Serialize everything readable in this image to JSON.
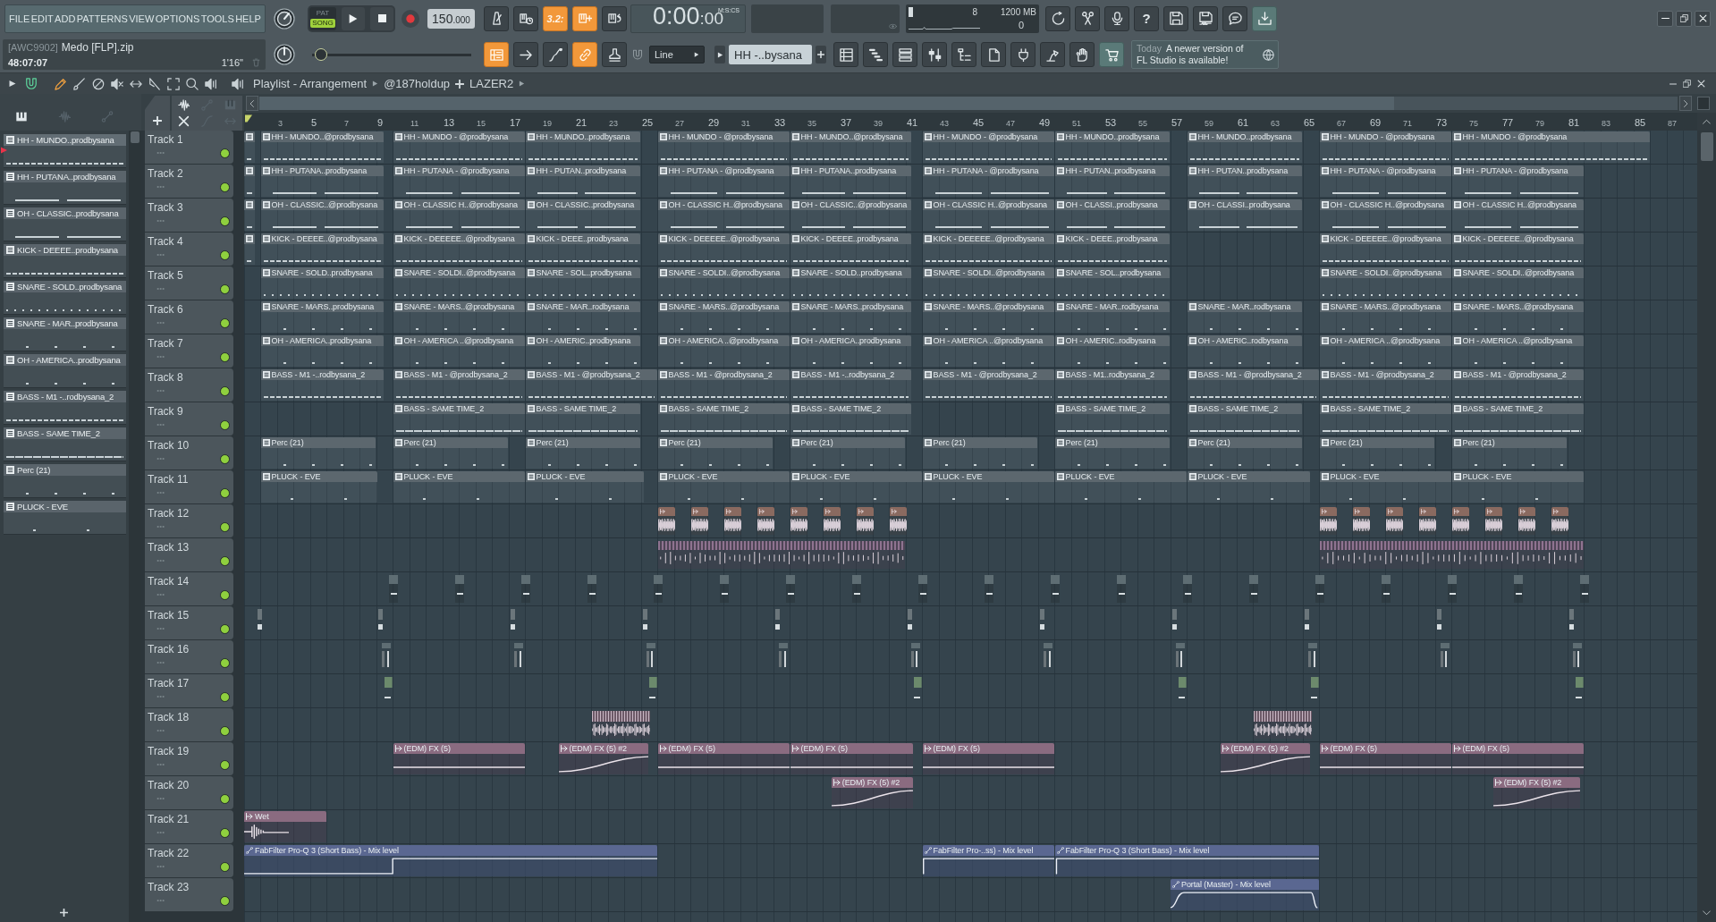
{
  "menu": [
    "FILE",
    "EDIT",
    "ADD",
    "PATTERNS",
    "VIEW",
    "OPTIONS",
    "TOOLS",
    "HELP"
  ],
  "transport": {
    "modes": [
      {
        "label": "PAT",
        "selected": false
      },
      {
        "label": "SONG",
        "selected": true
      }
    ]
  },
  "tempo": {
    "whole": "150",
    "fraction": ".000"
  },
  "record_toggles": [
    {
      "on": false
    },
    {
      "on": false
    },
    {
      "label": "3.2:",
      "on": true
    },
    {
      "on": true
    },
    {
      "on": false
    }
  ],
  "time": {
    "main": "0:00",
    "sub": ":00",
    "unit": "M:S:CS"
  },
  "monitor": {
    "readings": [
      "8",
      "1200 MB",
      "0"
    ]
  },
  "system_buttons": [
    {
      "on": false
    },
    {
      "on": false
    },
    {
      "on": false
    },
    {
      "label": "?",
      "on": false
    },
    {
      "on": false
    },
    {
      "on": false
    },
    {
      "on": false
    },
    {
      "on": true
    }
  ],
  "song": {
    "tag": "[AWC9902]",
    "file": "Medo [FLP].zip",
    "position": "48:07:07",
    "length": "1'16\""
  },
  "slider": {
    "level": 0.03
  },
  "view_toggles": [
    {
      "on": true
    },
    {
      "on": false
    },
    {
      "on": false
    },
    {
      "on": true
    },
    {
      "on": false
    }
  ],
  "snap": {
    "value": "Line"
  },
  "pattern_selector": {
    "value": "HH -..bysana"
  },
  "windows": [
    {
      "on": false
    },
    {
      "on": false
    },
    {
      "on": false
    },
    {
      "on": false
    },
    {
      "on": false
    },
    {
      "on": false
    },
    {
      "on": false
    },
    {
      "on": false
    },
    {
      "on": false
    },
    {
      "on": true
    }
  ],
  "news": {
    "date": "Today",
    "lines": [
      "A newer version of",
      "FL Studio is available!"
    ]
  },
  "playlist": {
    "snap_on": true,
    "tools": [
      {
        "selected": true
      },
      {
        "selected": false
      },
      {
        "selected": false
      },
      {
        "selected": false
      },
      {
        "selected": false
      },
      {
        "selected": false
      },
      {
        "selected": false
      },
      {
        "selected": false
      },
      {
        "selected": false
      }
    ],
    "breadcrumb": [
      "Playlist - Arrangement",
      "@187holdup",
      "LAZER2"
    ],
    "ruler": [
      "3",
      "5",
      "7",
      "9",
      "11",
      "13",
      "15",
      "17",
      "19",
      "21",
      "23",
      "25",
      "27",
      "29",
      "31",
      "33",
      "35",
      "37",
      "39",
      "41",
      "43",
      "45",
      "47",
      "49",
      "51",
      "53",
      "55",
      "57",
      "59",
      "61",
      "63",
      "65",
      "67",
      "69",
      "71",
      "73",
      "75",
      "77",
      "79",
      "81",
      "83",
      "85",
      "87"
    ]
  },
  "pattern_picker": {
    "items": [
      {
        "name": "HH - MUNDO..prodbysana",
        "selected": true
      },
      {
        "name": "HH - PUTANA..prodbysana",
        "selected": false
      },
      {
        "name": "OH - CLASSIC..prodbysana",
        "selected": false
      },
      {
        "name": "KICK - DEEEE..prodbysana",
        "selected": false
      },
      {
        "name": "SNARE - SOLD..prodbysana",
        "selected": false
      },
      {
        "name": "SNARE - MAR..prodbysana",
        "selected": false
      },
      {
        "name": "OH - AMERICA..prodbysana",
        "selected": false
      },
      {
        "name": "BASS - M1 -..rodbysana_2",
        "selected": false
      },
      {
        "name": "BASS - SAME TIME_2",
        "selected": false
      },
      {
        "name": "Perc (21)",
        "selected": false
      },
      {
        "name": "PLUCK - EVE",
        "selected": false
      }
    ]
  },
  "tracks": [
    {
      "name": "Track 1",
      "enabled": true,
      "clips": [
        {
          "kind": "pattern"
        },
        {
          "kind": "pattern",
          "label": "HH - MUNDO..@prodbysana"
        },
        {
          "kind": "pattern",
          "label": "HH - MUNDO - @prodbysana"
        },
        {
          "kind": "pattern",
          "label": "HH - MUNDO..prodbysana"
        },
        {
          "kind": "pattern",
          "label": "HH - MUNDO - @prodbysana"
        },
        {
          "kind": "pattern",
          "label": "HH - MUNDO..@prodbysana"
        },
        {
          "kind": "pattern",
          "label": "HH - MUNDO - @prodbysana"
        },
        {
          "kind": "pattern",
          "label": "HH - MUNDO..prodbysana"
        },
        {
          "kind": "pattern",
          "label": "HH - MUNDO..prodbysana"
        },
        {
          "kind": "pattern",
          "label": "HH - MUNDO - @prodbysana"
        },
        {
          "kind": "pattern",
          "label": "HH - MUNDO - @prodbysana"
        }
      ]
    },
    {
      "name": "Track 2",
      "enabled": true,
      "clips": [
        {
          "kind": "pattern"
        },
        {
          "kind": "pattern",
          "label": "HH - PUTANA..prodbysana"
        },
        {
          "kind": "pattern",
          "label": "HH - PUTANA - @prodbysana"
        },
        {
          "kind": "pattern",
          "label": "HH - PUTAN..prodbysana"
        },
        {
          "kind": "pattern",
          "label": "HH - PUTANA - @prodbysana"
        },
        {
          "kind": "pattern",
          "label": "HH - PUTANA..prodbysana"
        },
        {
          "kind": "pattern",
          "label": "HH - PUTANA - @prodbysana"
        },
        {
          "kind": "pattern",
          "label": "HH - PUTAN..prodbysana"
        },
        {
          "kind": "pattern",
          "label": "HH - PUTAN..prodbysana"
        },
        {
          "kind": "pattern",
          "label": "HH - PUTANA - @prodbysana"
        },
        {
          "kind": "pattern",
          "label": "HH - PUTANA - @prodbysana"
        }
      ]
    },
    {
      "name": "Track 3",
      "enabled": true,
      "clips": [
        {
          "kind": "pattern"
        },
        {
          "kind": "pattern",
          "label": "OH - CLASSIC..@prodbysana"
        },
        {
          "kind": "pattern",
          "label": "OH - CLASSIC H..@prodbysana"
        },
        {
          "kind": "pattern",
          "label": "OH - CLASSIC..prodbysana"
        },
        {
          "kind": "pattern",
          "label": "OH - CLASSIC H..@prodbysana"
        },
        {
          "kind": "pattern",
          "label": "OH - CLASSIC..@prodbysana"
        },
        {
          "kind": "pattern",
          "label": "OH - CLASSIC H..@prodbysana"
        },
        {
          "kind": "pattern",
          "label": "OH - CLASSI..prodbysana"
        },
        {
          "kind": "pattern",
          "label": "OH - CLASSI..prodbysana"
        },
        {
          "kind": "pattern",
          "label": "OH - CLASSIC H..@prodbysana"
        },
        {
          "kind": "pattern",
          "label": "OH - CLASSIC H..@prodbysana"
        }
      ]
    },
    {
      "name": "Track 4",
      "enabled": true,
      "clips": [
        {
          "kind": "pattern"
        },
        {
          "kind": "pattern",
          "label": "KICK - DEEEE..@prodbysana"
        },
        {
          "kind": "pattern",
          "label": "KICK - DEEEEE..@prodbysana"
        },
        {
          "kind": "pattern",
          "label": "KICK - DEEE..prodbysana"
        },
        {
          "kind": "pattern",
          "label": "KICK - DEEEEE..@prodbysana"
        },
        {
          "kind": "pattern",
          "label": "KICK - DEEEE..prodbysana"
        },
        {
          "kind": "pattern",
          "label": "KICK - DEEEEE..@prodbysana"
        },
        {
          "kind": "pattern",
          "label": "KICK - DEEE..prodbysana"
        },
        {
          "kind": "pattern",
          "label": "KICK - DEEEEE..@prodbysana"
        },
        {
          "kind": "pattern",
          "label": "KICK - DEEEEE..@prodbysana"
        }
      ]
    },
    {
      "name": "Track 5",
      "enabled": true,
      "clips": [
        {
          "kind": "pattern",
          "label": "SNARE - SOLD..prodbysana"
        },
        {
          "kind": "pattern",
          "label": "SNARE - SOLDI..@prodbysana"
        },
        {
          "kind": "pattern",
          "label": "SNARE - SOL..prodbysana"
        },
        {
          "kind": "pattern",
          "label": "SNARE - SOLDI..@prodbysana"
        },
        {
          "kind": "pattern",
          "label": "SNARE - SOLD..prodbysana"
        },
        {
          "kind": "pattern",
          "label": "SNARE - SOLDI..@prodbysana"
        },
        {
          "kind": "pattern",
          "label": "SNARE - SOL..prodbysana"
        },
        {
          "kind": "pattern",
          "label": "SNARE - SOLDI..@prodbysana"
        },
        {
          "kind": "pattern",
          "label": "SNARE - SOLDI..@prodbysana"
        }
      ]
    },
    {
      "name": "Track 6",
      "enabled": true,
      "clips": [
        {
          "kind": "pattern",
          "label": "SNARE - MARS..prodbysana"
        },
        {
          "kind": "pattern",
          "label": "SNARE - MARS..@prodbysana"
        },
        {
          "kind": "pattern",
          "label": "SNARE - MAR..rodbysana"
        },
        {
          "kind": "pattern",
          "label": "SNARE - MARS..@prodbysana"
        },
        {
          "kind": "pattern",
          "label": "SNARE - MARS..prodbysana"
        },
        {
          "kind": "pattern",
          "label": "SNARE - MARS..@prodbysana"
        },
        {
          "kind": "pattern",
          "label": "SNARE - MAR..rodbysana"
        },
        {
          "kind": "pattern",
          "label": "SNARE - MAR..rodbysana"
        },
        {
          "kind": "pattern",
          "label": "SNARE - MARS..@prodbysana"
        },
        {
          "kind": "pattern",
          "label": "SNARE - MARS..@prodbysana"
        }
      ]
    },
    {
      "name": "Track 7",
      "enabled": true,
      "clips": [
        {
          "kind": "pattern",
          "label": "OH - AMERICA..prodbysana"
        },
        {
          "kind": "pattern",
          "label": "OH - AMERICA ..@prodbysana"
        },
        {
          "kind": "pattern",
          "label": "OH - AMERIC..prodbysana"
        },
        {
          "kind": "pattern",
          "label": "OH - AMERICA ..@prodbysana"
        },
        {
          "kind": "pattern",
          "label": "OH - AMERICA..prodbysana"
        },
        {
          "kind": "pattern",
          "label": "OH - AMERICA ..@prodbysana"
        },
        {
          "kind": "pattern",
          "label": "OH - AMERIC..rodbysana"
        },
        {
          "kind": "pattern",
          "label": "OH - AMERIC..rodbysana"
        },
        {
          "kind": "pattern",
          "label": "OH - AMERICA ..@prodbysana"
        },
        {
          "kind": "pattern",
          "label": "OH - AMERICA ..@prodbysana"
        }
      ]
    },
    {
      "name": "Track 8",
      "enabled": true,
      "clips": [
        {
          "kind": "pattern",
          "label": "BASS - M1 -..rodbysana_2"
        },
        {
          "kind": "pattern",
          "label": "BASS - M1 - @prodbysana_2"
        },
        {
          "kind": "pattern",
          "label": "BASS - M1 - @prodbysana_2"
        },
        {
          "kind": "pattern",
          "label": "BASS - M1 - @prodbysana_2"
        },
        {
          "kind": "pattern",
          "label": "BASS - M1 -..rodbysana_2"
        },
        {
          "kind": "pattern",
          "label": "BASS - M1 - @prodbysana_2"
        },
        {
          "kind": "pattern",
          "label": "BASS - M1..rodbysana_2"
        },
        {
          "kind": "pattern",
          "label": "BASS - M1 - @prodbysana_2"
        },
        {
          "kind": "pattern",
          "label": "BASS - M1 - @prodbysana_2"
        },
        {
          "kind": "pattern",
          "label": "BASS - M1 - @prodbysana_2"
        }
      ]
    },
    {
      "name": "Track 9",
      "enabled": true,
      "clips": [
        {
          "kind": "pattern",
          "label": "BASS - SAME TIME_2"
        },
        {
          "kind": "pattern",
          "label": "BASS - SAME TIME_2"
        },
        {
          "kind": "pattern",
          "label": "BASS - SAME TIME_2"
        },
        {
          "kind": "pattern",
          "label": "BASS - SAME TIME_2"
        },
        {
          "kind": "pattern",
          "label": "BASS - SAME TIME_2"
        },
        {
          "kind": "pattern",
          "label": "BASS - SAME TIME_2"
        },
        {
          "kind": "pattern",
          "label": "BASS - SAME TIME_2"
        },
        {
          "kind": "pattern",
          "label": "BASS - SAME TIME_2"
        }
      ]
    },
    {
      "name": "Track 10",
      "enabled": true,
      "clips": [
        {
          "kind": "pattern",
          "label": "Perc (21)"
        },
        {
          "kind": "pattern",
          "label": "Perc (21)"
        },
        {
          "kind": "pattern",
          "label": "Perc (21)"
        },
        {
          "kind": "pattern",
          "label": "Perc (21)"
        },
        {
          "kind": "pattern",
          "label": "Perc (21)"
        },
        {
          "kind": "pattern",
          "label": "Perc (21)"
        },
        {
          "kind": "pattern",
          "label": "Perc (21)"
        },
        {
          "kind": "pattern",
          "label": "Perc (21)"
        },
        {
          "kind": "pattern",
          "label": "Perc (21)"
        },
        {
          "kind": "pattern",
          "label": "Perc (21)"
        }
      ]
    },
    {
      "name": "Track 11",
      "enabled": true,
      "clips": [
        {
          "kind": "pattern",
          "label": "PLUCK - EVE"
        },
        {
          "kind": "pattern",
          "label": "PLUCK - EVE"
        },
        {
          "kind": "pattern",
          "label": "PLUCK - EVE"
        },
        {
          "kind": "pattern",
          "label": "PLUCK - EVE"
        },
        {
          "kind": "pattern",
          "label": "PLUCK - EVE"
        },
        {
          "kind": "pattern",
          "label": "PLUCK - EVE"
        },
        {
          "kind": "pattern",
          "label": "PLUCK - EVE"
        },
        {
          "kind": "pattern",
          "label": "PLUCK - EVE"
        },
        {
          "kind": "pattern",
          "label": "PLUCK - EVE"
        },
        {
          "kind": "pattern",
          "label": "PLUCK - EVE"
        }
      ]
    },
    {
      "name": "Track 12",
      "enabled": true,
      "clips": [
        {
          "kind": "audio"
        },
        {
          "kind": "audio"
        },
        {
          "kind": "audio"
        },
        {
          "kind": "audio"
        },
        {
          "kind": "audio"
        },
        {
          "kind": "audio"
        },
        {
          "kind": "audio"
        },
        {
          "kind": "audio"
        },
        {
          "kind": "audio"
        },
        {
          "kind": "audio"
        },
        {
          "kind": "audio"
        },
        {
          "kind": "audio"
        },
        {
          "kind": "audio"
        },
        {
          "kind": "audio"
        },
        {
          "kind": "audio"
        },
        {
          "kind": "audio"
        }
      ]
    },
    {
      "name": "Track 13",
      "enabled": true,
      "clips": [
        {
          "kind": "audio"
        },
        {
          "kind": "audio"
        }
      ]
    },
    {
      "name": "Track 14",
      "enabled": true,
      "clips": [
        {
          "kind": "audio"
        },
        {
          "kind": "audio"
        },
        {
          "kind": "audio"
        },
        {
          "kind": "audio"
        },
        {
          "kind": "audio"
        },
        {
          "kind": "audio"
        },
        {
          "kind": "audio"
        },
        {
          "kind": "audio"
        },
        {
          "kind": "audio"
        },
        {
          "kind": "audio"
        },
        {
          "kind": "audio"
        },
        {
          "kind": "audio"
        },
        {
          "kind": "audio"
        },
        {
          "kind": "audio"
        },
        {
          "kind": "audio"
        },
        {
          "kind": "audio"
        },
        {
          "kind": "audio"
        },
        {
          "kind": "audio"
        },
        {
          "kind": "audio"
        }
      ]
    },
    {
      "name": "Track 15",
      "enabled": true,
      "clips": [
        {
          "kind": "audio"
        },
        {
          "kind": "audio"
        },
        {
          "kind": "audio"
        },
        {
          "kind": "audio"
        },
        {
          "kind": "audio"
        },
        {
          "kind": "audio"
        },
        {
          "kind": "audio"
        },
        {
          "kind": "audio"
        },
        {
          "kind": "audio"
        },
        {
          "kind": "audio"
        },
        {
          "kind": "audio"
        }
      ]
    },
    {
      "name": "Track 16",
      "enabled": true,
      "clips": [
        {
          "kind": "audio"
        },
        {
          "kind": "audio"
        },
        {
          "kind": "audio"
        },
        {
          "kind": "audio"
        },
        {
          "kind": "audio"
        },
        {
          "kind": "audio"
        },
        {
          "kind": "audio"
        },
        {
          "kind": "audio"
        },
        {
          "kind": "audio"
        },
        {
          "kind": "audio"
        }
      ]
    },
    {
      "name": "Track 17",
      "enabled": true,
      "clips": [
        {
          "kind": "audio"
        },
        {
          "kind": "audio"
        },
        {
          "kind": "audio"
        },
        {
          "kind": "audio"
        },
        {
          "kind": "audio"
        },
        {
          "kind": "audio"
        }
      ]
    },
    {
      "name": "Track 18",
      "enabled": true,
      "clips": [
        {
          "kind": "audio"
        },
        {
          "kind": "audio"
        }
      ]
    },
    {
      "name": "Track 19",
      "enabled": true,
      "clips": [
        {
          "kind": "audio",
          "label": "(EDM) FX (5)"
        },
        {
          "kind": "audio",
          "label": "(EDM) FX (5) #2"
        },
        {
          "kind": "audio",
          "label": "(EDM) FX (5)"
        },
        {
          "kind": "audio",
          "label": "(EDM) FX (5)"
        },
        {
          "kind": "audio",
          "label": "(EDM) FX (5)"
        },
        {
          "kind": "audio",
          "label": "(EDM) FX (5) #2"
        },
        {
          "kind": "audio",
          "label": "(EDM) FX (5)"
        },
        {
          "kind": "audio",
          "label": "(EDM) FX (5)"
        }
      ]
    },
    {
      "name": "Track 20",
      "enabled": true,
      "clips": [
        {
          "kind": "audio",
          "label": "(EDM) FX (5) #2"
        },
        {
          "kind": "audio",
          "label": "(EDM) FX (5) #2"
        }
      ]
    },
    {
      "name": "Track 21",
      "enabled": true,
      "clips": [
        {
          "kind": "audio",
          "label": "Wet"
        }
      ]
    },
    {
      "name": "Track 22",
      "enabled": true,
      "clips": [
        {
          "kind": "automation",
          "label": "FabFilter Pro-Q 3 (Short Bass) - Mix level"
        },
        {
          "kind": "automation",
          "label": "FabFilter Pro-..ss) - Mix level"
        },
        {
          "kind": "automation",
          "label": "FabFilter Pro-Q 3 (Short Bass) - Mix level"
        }
      ]
    },
    {
      "name": "Track 23",
      "enabled": true,
      "clips": [
        {
          "kind": "automation",
          "label": "Portal (Master) - Mix level"
        }
      ]
    }
  ]
}
